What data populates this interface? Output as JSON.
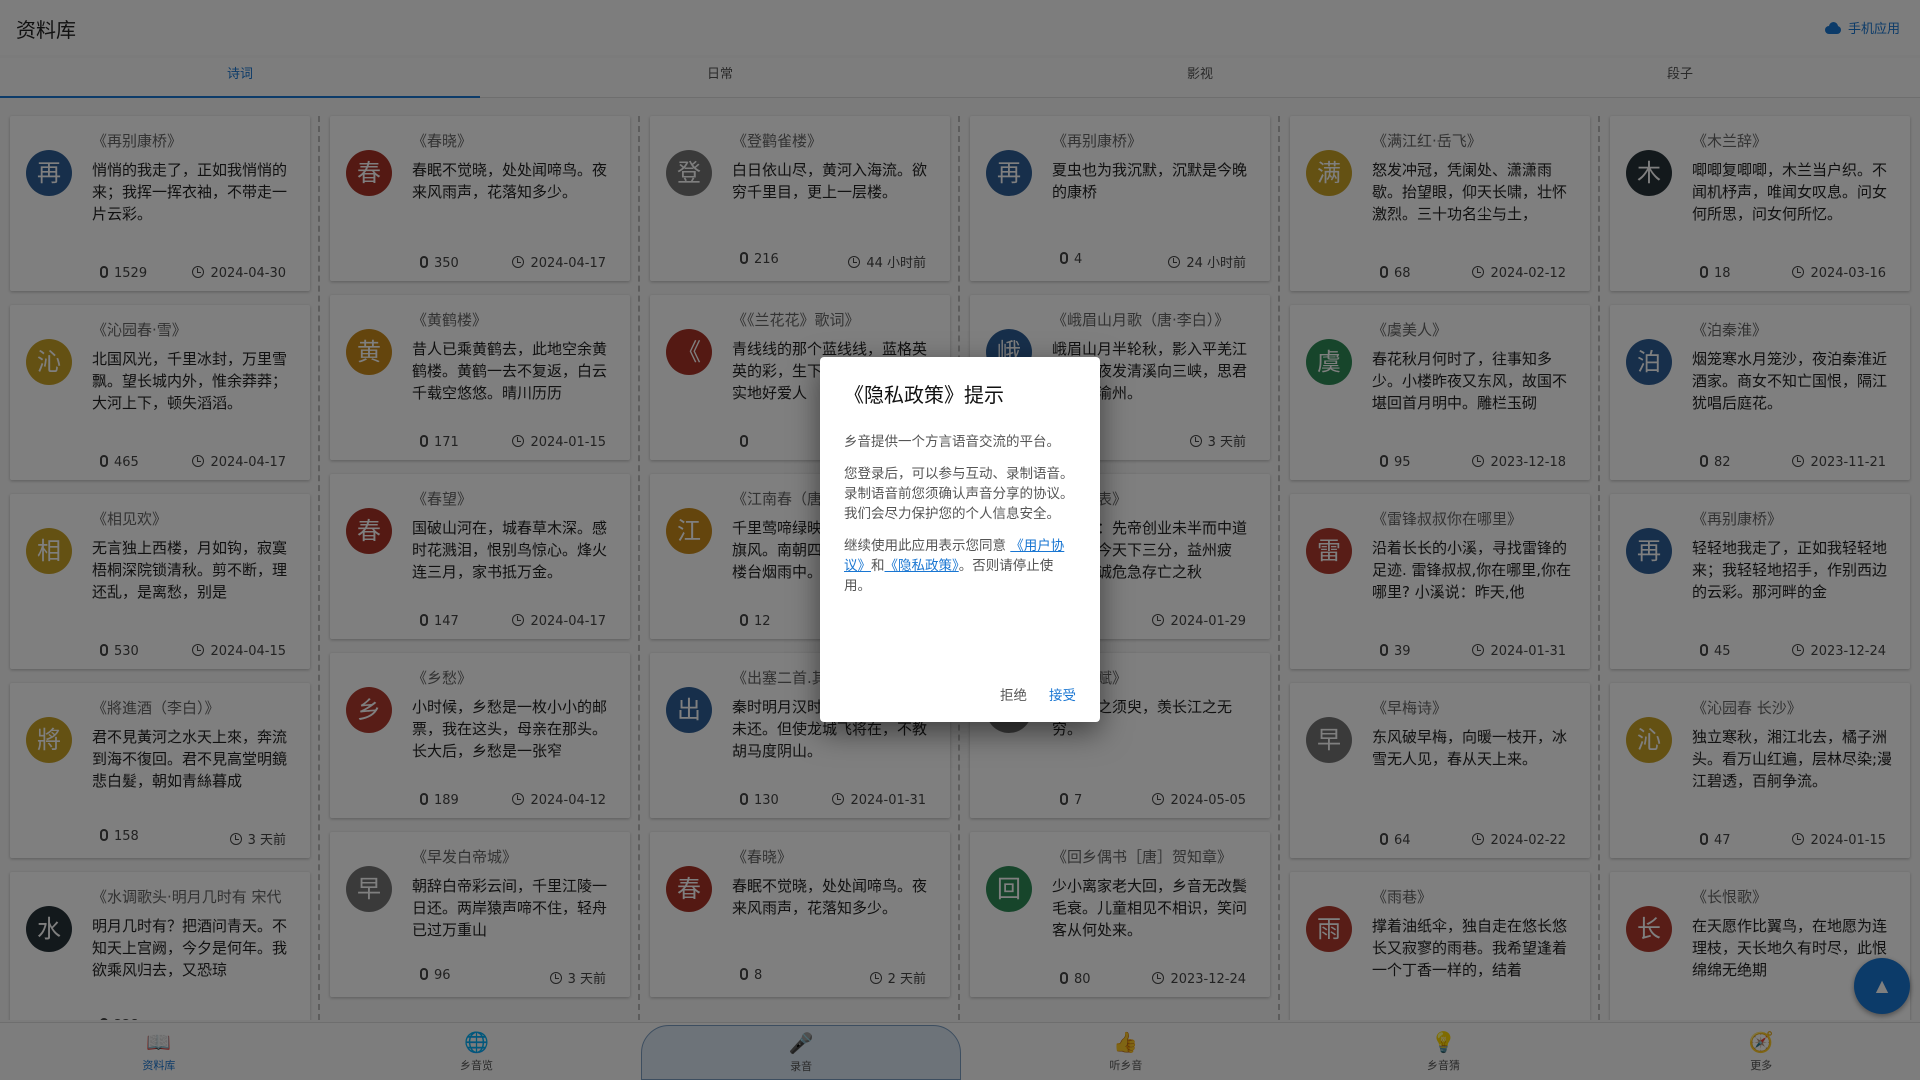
{
  "header": {
    "title": "资料库",
    "mobile_app_label": "手机应用"
  },
  "tabs": [
    "诗词",
    "日常",
    "影视",
    "段子"
  ],
  "colors": {
    "accent": "#1976d2",
    "overlay": "rgba(0,0,0,0.5)"
  },
  "columns": [
    [
      {
        "avatar": "再",
        "color": "#2f5f96",
        "title": "《再别康桥》",
        "text": "悄悄的我走了，正如我悄悄的来；我挥一挥衣袖，不带走一片云彩。",
        "count": "1529",
        "time": "2024-04-30",
        "tall": true
      },
      {
        "avatar": "沁",
        "color": "#c9a226",
        "title": "《沁园春·雪》",
        "text": "北国风光，千里冰封，万里雪飘。望长城内外，惟余莽莽；大河上下，顿失滔滔。",
        "count": "465",
        "time": "2024-04-17",
        "tall": true
      },
      {
        "avatar": "相",
        "color": "#c9a226",
        "title": "《相见欢》",
        "text": "无言独上西楼，月如钩，寂寞梧桐深院锁清秋。剪不断，理还乱，是离愁，别是",
        "count": "530",
        "time": "2024-04-15",
        "tall": true
      },
      {
        "avatar": "將",
        "color": "#c9a226",
        "title": "《將進酒（李白）》",
        "text": "君不見黃河之水天上來，奔流到海不復回。君不見高堂明鏡悲白髮，朝如青絲暮成",
        "count": "158",
        "time": "3 天前",
        "tall": true
      },
      {
        "avatar": "水",
        "color": "#263238",
        "title": "《水调歌头·明月几时有 宋代",
        "text": "明月几时有？把酒问青天。不知天上宫阙，今夕是何年。我欲乘风归去，又恐琼",
        "count": "228",
        "time": "3 天前",
        "tall": true
      }
    ],
    [
      {
        "avatar": "春",
        "color": "#a93226",
        "title": "《春晓》",
        "text": "春眠不觉晓，处处闻啼鸟。夜来风雨声，花落知多少。",
        "count": "350",
        "time": "2024-04-17"
      },
      {
        "avatar": "黄",
        "color": "#c98a1a",
        "title": "《黄鹤楼》",
        "text": "昔人已乘黄鹤去，此地空余黄鹤楼。黄鹤一去不复返，白云千载空悠悠。晴川历历",
        "count": "171",
        "time": "2024-01-15"
      },
      {
        "avatar": "春",
        "color": "#a93226",
        "title": "《春望》",
        "text": "国破山河在，城春草木深。感时花溅泪，恨别鸟惊心。烽火连三月，家书抵万金。",
        "count": "147",
        "time": "2024-04-17"
      },
      {
        "avatar": "乡",
        "color": "#b03a2e",
        "title": "《乡愁》",
        "text": "小时候，乡愁是一枚小小的邮票，我在这头，母亲在那头。长大后，乡愁是一张窄",
        "count": "189",
        "time": "2024-04-12"
      },
      {
        "avatar": "早",
        "color": "#757575",
        "title": "《早发白帝城》",
        "text": "朝辞白帝彩云间，千里江陵一日还。两岸猿声啼不住，轻舟已过万重山",
        "count": "96",
        "time": "3 天前"
      }
    ],
    [
      {
        "avatar": "登",
        "color": "#757575",
        "title": "《登鹳雀楼》",
        "text": "白日依山尽，黄河入海流。欲穷千里目，更上一层楼。",
        "count": "216",
        "time": "44 小时前"
      },
      {
        "avatar": "《",
        "color": "#a93226",
        "title": "《《兰花花》歌词》",
        "text": "青线线的那个蓝线线，蓝格英英的彩，生下一个兰花花，实实地好爱人",
        "count": "",
        "time": ""
      },
      {
        "avatar": "江",
        "color": "#c98a1a",
        "title": "《江南春（唐）杜牧》",
        "text": "千里莺啼绿映红，水村山郭酒旗风。南朝四百八十寺，多少楼台烟雨中。",
        "count": "12",
        "time": ""
      },
      {
        "avatar": "出",
        "color": "#2f5f96",
        "title": "《出塞二首.其一》",
        "text": "秦时明月汉时关，万里长征人未还。但使龙城飞将在，不教胡马度阴山。",
        "count": "130",
        "time": "2024-01-31"
      },
      {
        "avatar": "春",
        "color": "#a93226",
        "title": "《春晓》",
        "text": "春眠不觉晓，处处闻啼鸟。夜来风雨声，花落知多少。",
        "count": "8",
        "time": "2 天前"
      }
    ],
    [
      {
        "avatar": "再",
        "color": "#2f5f96",
        "title": "《再别康桥》",
        "text": "夏虫也为我沉默，沉默是今晚的康桥",
        "count": "4",
        "time": "24 小时前"
      },
      {
        "avatar": "峨",
        "color": "#2f5f96",
        "title": "《峨眉山月歌（唐·李白）》",
        "text": "峨眉山月半轮秋，影入平羌江水流。夜发清溪向三峡，思君不见下渝州。",
        "count": "6",
        "time": "3 天前"
      },
      {
        "avatar": "出",
        "color": "#2f5f96",
        "title": "《出师表》",
        "text": "臣亮言：先帝创业未半而中道崩殂，今天下三分，益州疲弊，此诚危急存亡之秋",
        "count": "",
        "time": "2024-01-29"
      },
      {
        "avatar": "赤",
        "color": "#757575",
        "title": "《赤壁赋》",
        "text": "哀吾生之须臾，羡长江之无穷。",
        "count": "7",
        "time": "2024-05-05"
      },
      {
        "avatar": "回",
        "color": "#2e8b57",
        "title": "《回乡偶书［唐］贺知章》",
        "text": "少小离家老大回，乡音无改鬓毛衰。儿童相见不相识，笑问客从何处来。",
        "count": "80",
        "time": "2023-12-24"
      }
    ],
    [
      {
        "avatar": "满",
        "color": "#c9a226",
        "title": "《满江红·岳飞》",
        "text": "怒发冲冠，凭阑处、潇潇雨歇。抬望眼，仰天长啸，壮怀激烈。三十功名尘与土，",
        "count": "68",
        "time": "2024-02-12",
        "tall": true
      },
      {
        "avatar": "虞",
        "color": "#2e8b57",
        "title": "《虞美人》",
        "text": "春花秋月何时了，往事知多少。小楼昨夜又东风，故国不堪回首月明中。雕栏玉砌",
        "count": "95",
        "time": "2023-12-18",
        "tall": true
      },
      {
        "avatar": "雷",
        "color": "#b03a2e",
        "title": "《雷锋叔叔你在哪里》",
        "text": "沿着长长的小溪，寻找雷锋的足迹. 雷锋叔叔,你在哪里,你在哪里? 小溪说：昨天,他",
        "count": "39",
        "time": "2024-01-31",
        "tall": true
      },
      {
        "avatar": "早",
        "color": "#757575",
        "title": "《早梅诗》",
        "text": "东风破早梅，向暖一枝开，冰雪无人见，春从天上来。",
        "count": "64",
        "time": "2024-02-22",
        "tall": true
      },
      {
        "avatar": "雨",
        "color": "#b03a2e",
        "title": "《雨巷》",
        "text": "撑着油纸伞，独自走在悠长悠长又寂寥的雨巷。我希望逢着一个丁香一样的，结着",
        "count": "99",
        "time": "2024-03-21",
        "tall": true
      }
    ],
    [
      {
        "avatar": "木",
        "color": "#263238",
        "title": "《木兰辞》",
        "text": "唧唧复唧唧，木兰当户织。不闻机杼声，唯闻女叹息。问女何所思，问女何所忆。",
        "count": "18",
        "time": "2024-03-16",
        "tall": true
      },
      {
        "avatar": "泊",
        "color": "#2f5f96",
        "title": "《泊秦淮》",
        "text": "烟笼寒水月笼沙，夜泊秦淮近酒家。商女不知亡国恨，隔江犹唱后庭花。",
        "count": "82",
        "time": "2023-11-21",
        "tall": true
      },
      {
        "avatar": "再",
        "color": "#2f5f96",
        "title": "《再别康桥》",
        "text": "轻轻地我走了，正如我轻轻地来；我轻轻地招手，作别西边的云彩。那河畔的金",
        "count": "45",
        "time": "2023-12-24",
        "tall": true
      },
      {
        "avatar": "沁",
        "color": "#c9a226",
        "title": "《沁园春 长沙》",
        "text": "独立寒秋，湘江北去，橘子洲头。看万山红遍，层林尽染;漫江碧透，百舸争流。",
        "count": "47",
        "time": "2024-01-15",
        "tall": true
      },
      {
        "avatar": "长",
        "color": "#b03a2e",
        "title": "《长恨歌》",
        "text": "在天愿作比翼鸟，在地愿为连理枝，天长地久有时尽，此恨绵绵无绝期",
        "count": "92",
        "time": "2024-03",
        "tall": true
      }
    ]
  ],
  "bottom_nav": [
    {
      "icon": "📖",
      "label": "资料库",
      "active": true
    },
    {
      "icon": "🌐",
      "label": "乡音览"
    },
    {
      "icon": "🎤",
      "label": "录音",
      "record": true
    },
    {
      "icon": "👍",
      "label": "听乡音"
    },
    {
      "icon": "💡",
      "label": "乡音猜"
    },
    {
      "icon": "🧭",
      "label": "更多"
    }
  ],
  "fab_icon": "▲",
  "dialog": {
    "title": "《隐私政策》提示",
    "p1": "乡音提供一个方言语音交流的平台。",
    "p2": "您登录后，可以参与互动、录制语音。录制语音前您须确认声音分享的协议。我们会尽力保护您的个人信息安全。",
    "p3_prefix": "继续使用此应用表示您同意",
    "user_agreement": "《用户协议》",
    "and": "和",
    "privacy_policy": "《隐私政策》",
    "p3_suffix": "。否则请停止使用。",
    "reject": "拒绝",
    "accept": "接受"
  }
}
